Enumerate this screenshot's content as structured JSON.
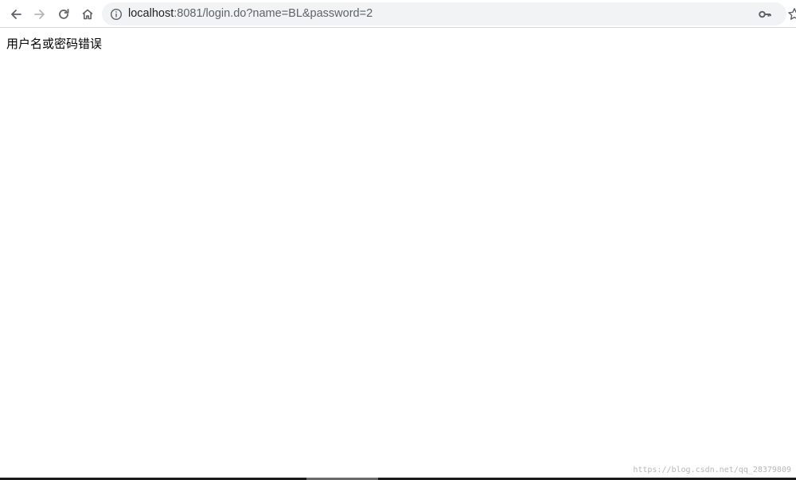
{
  "browser": {
    "address_bar": {
      "host": "localhost",
      "rest": ":8081/login.do?name=BL&password=2"
    },
    "icons": {
      "back": "back-arrow-icon",
      "forward": "forward-arrow-icon",
      "reload": "reload-icon",
      "home": "home-icon",
      "site_info": "info-icon",
      "password": "key-icon",
      "bookmark": "star-icon"
    }
  },
  "page": {
    "message": "用户名或密码错误"
  },
  "watermark": {
    "text": "https://blog.csdn.net/qq_28379809"
  }
}
